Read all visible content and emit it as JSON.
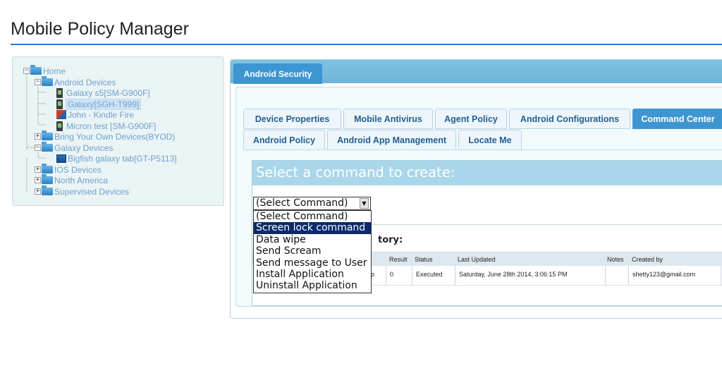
{
  "app": {
    "title": "Mobile Policy Manager"
  },
  "tree": {
    "home": "Home",
    "android_devices": "Android Devices",
    "galaxy_s5": "Galaxy s5[SM-G900F]",
    "galaxy_sgh": "Galaxy[SGH-T999]",
    "john_kindle": "John - Kindle Fire",
    "micron_test": "Micron test [SM-G900F]",
    "byod": "Bring Your Own Devices(BYOD)",
    "galaxy_devices": "Galaxy Devices",
    "bigfish": "Bigfish galaxy tab[GT-P5113]",
    "ios_devices": "IOS Devices",
    "north_america": "North America",
    "supervised": "Supervised Devices"
  },
  "main": {
    "tab_label": "Android Security"
  },
  "tabs": [
    "Device Properties",
    "Mobile Antivirus",
    "Agent Policy",
    "Android Configurations",
    "Command Center",
    "Android Policy",
    "Android App Management",
    "Locate Me"
  ],
  "command": {
    "header": "Select a command to create:",
    "select_value": "(Select Command)",
    "options": [
      "(Select Command)",
      "Screen lock command",
      "Data wipe",
      "Send Scream",
      "Send message to User",
      "Install Application",
      "Uninstall Application"
    ],
    "highlighted_option": "Screen lock command"
  },
  "history": {
    "heading_visible": "tory:",
    "columns": [
      "Result",
      "Status",
      "Last Updated",
      "Notes",
      "Created by"
    ],
    "row": {
      "partial": "p",
      "result": "0",
      "status": "Executed",
      "last_updated": "Saturday, June 28th 2014, 3:06:15 PM",
      "notes": "",
      "created_by": "shetty123@gmail.com"
    }
  }
}
